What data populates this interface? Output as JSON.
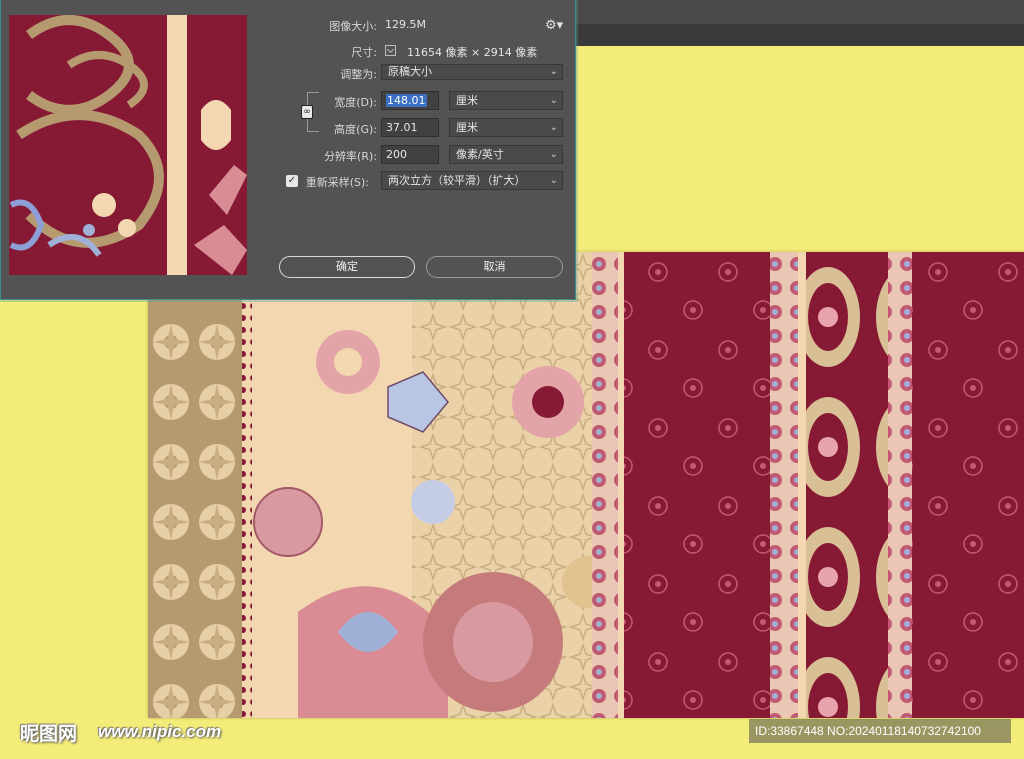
{
  "colors": {
    "dialog_bg": "#535353",
    "field_bg": "#414141",
    "selection": "#3a6fc4",
    "canvas_bg": "#f4ec78",
    "pattern_crimson": "#861a35",
    "pattern_cream": "#f3d7b0",
    "pattern_tan": "#b59a70",
    "pattern_pink": "#d48a92",
    "pattern_blue": "#9fb1d6"
  },
  "dialog": {
    "image_size_label": "图像大小:",
    "image_size_value": "129.5M",
    "settings_icon": "gear-icon",
    "dimensions_label": "尺寸:",
    "dimensions_value": "11654 像素 × 2914 像素",
    "fit_to_label": "调整为:",
    "fit_to_value": "原稿大小",
    "width_label": "宽度(D):",
    "width_value": "148.01",
    "width_unit": "厘米",
    "height_label": "高度(G):",
    "height_value": "37.01",
    "height_unit": "厘米",
    "resolution_label": "分辨率(R):",
    "resolution_value": "200",
    "resolution_unit": "像素/英寸",
    "resample_label": "重新采样(S):",
    "resample_checked": true,
    "resample_value": "两次立方（较平滑）（扩大）",
    "ok_label": "确定",
    "cancel_label": "取消",
    "link_icon": "chain-link-icon"
  },
  "watermark": {
    "logo_text": "昵图网",
    "url_text": "www.nipic.com",
    "id_text": "ID:33867448 NO:20240118140732742100"
  }
}
